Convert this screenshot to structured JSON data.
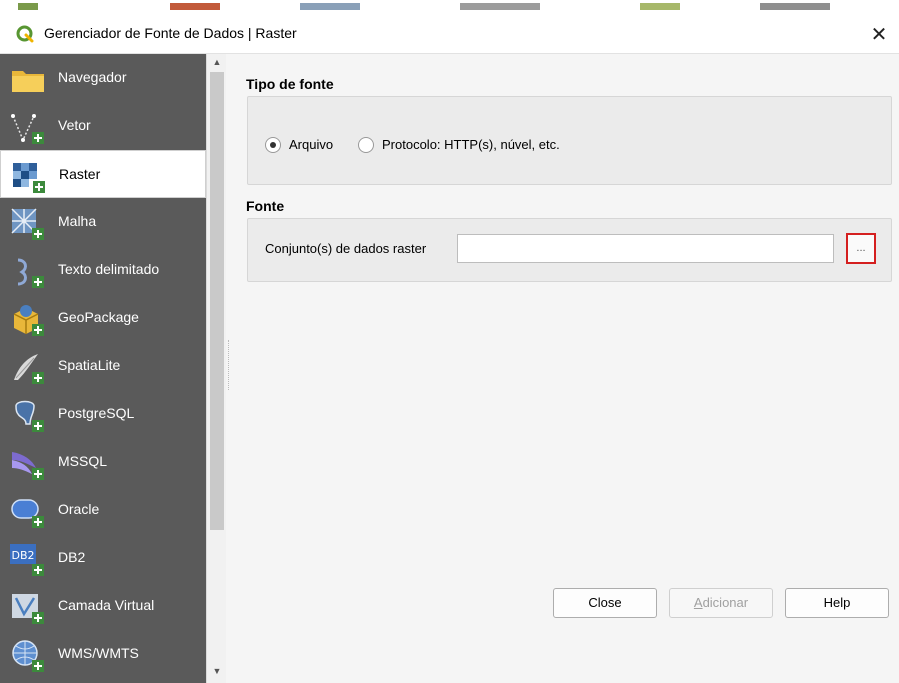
{
  "window": {
    "title": "Gerenciador de Fonte de Dados | Raster",
    "close_glyph": "✕"
  },
  "sidebar": {
    "items": [
      {
        "label": "Navegador",
        "icon": "folder-icon"
      },
      {
        "label": "Vetor",
        "icon": "vector-icon"
      },
      {
        "label": "Raster",
        "icon": "raster-icon",
        "active": true
      },
      {
        "label": "Malha",
        "icon": "mesh-icon"
      },
      {
        "label": "Texto delimitado",
        "icon": "delimited-text-icon"
      },
      {
        "label": "GeoPackage",
        "icon": "geopackage-icon"
      },
      {
        "label": "SpatiaLite",
        "icon": "spatialite-icon"
      },
      {
        "label": "PostgreSQL",
        "icon": "postgresql-icon"
      },
      {
        "label": "MSSQL",
        "icon": "mssql-icon"
      },
      {
        "label": "Oracle",
        "icon": "oracle-icon"
      },
      {
        "label": "DB2",
        "icon": "db2-icon"
      },
      {
        "label": "Camada Virtual",
        "icon": "virtual-layer-icon"
      },
      {
        "label": "WMS/WMTS",
        "icon": "wms-icon"
      }
    ]
  },
  "source_type": {
    "title": "Tipo de fonte",
    "options": [
      {
        "label": "Arquivo",
        "selected": true
      },
      {
        "label": "Protocolo: HTTP(s), núvel, etc.",
        "selected": false
      }
    ]
  },
  "source": {
    "title": "Fonte",
    "field_label": "Conjunto(s) de dados raster",
    "field_value": "",
    "browse_label": "..."
  },
  "buttons": {
    "close": "Close",
    "add_prefix": "A",
    "add_rest": "dicionar",
    "help": "Help"
  },
  "colors": {
    "sidebar_bg": "#5a5a5a",
    "highlight": "#d41f1f",
    "qgis_green": "#589632"
  }
}
